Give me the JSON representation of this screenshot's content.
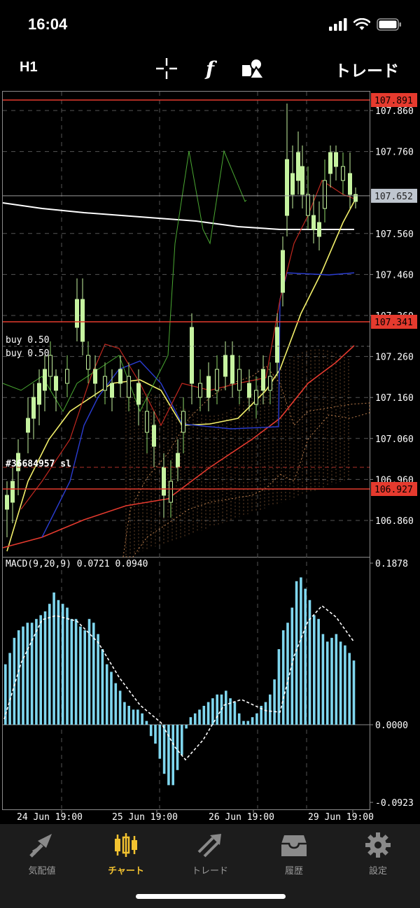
{
  "status": {
    "time": "16:04"
  },
  "toolbar": {
    "timeframe": "H1",
    "trade_label": "トレード",
    "icons": [
      "crosshair-icon",
      "function-icon",
      "objects-icon"
    ]
  },
  "chart": {
    "price_ticks": [
      "107.860",
      "107.760",
      "107.652",
      "107.560",
      "107.460",
      "107.360",
      "107.260",
      "107.160",
      "107.060",
      "106.960",
      "106.860"
    ],
    "level_labels": [
      "107.891",
      "107.341",
      "106.927"
    ],
    "current_price": "107.652",
    "order_labels": [
      "buy 0.50",
      "buy 0.50",
      "#36684957 sl"
    ],
    "macd_title": "MACD(9,20,9) 0.0721 0.0940",
    "macd_ticks": [
      "0.1878",
      "0.0000",
      "-0.0923"
    ],
    "time_labels": [
      "24 Jun 19:00",
      "25 Jun 19:00",
      "26 Jun 19:00",
      "29 Jun 19:00"
    ],
    "colors": {
      "resistance": "#e53a2e",
      "sl": "#e53a2e",
      "bull": "#c6f3a0",
      "ma_yellow": "#f2ef6a",
      "ma_white": "#ffffff",
      "macd_bar": "#7fd6ee",
      "cloud": "#f0a060"
    }
  },
  "tabs": [
    {
      "label": "気配値",
      "icon": "quotes-icon"
    },
    {
      "label": "チャート",
      "icon": "chart-icon",
      "active": true
    },
    {
      "label": "トレード",
      "icon": "trade-icon"
    },
    {
      "label": "履歴",
      "icon": "history-icon"
    },
    {
      "label": "設定",
      "icon": "settings-icon"
    }
  ]
}
